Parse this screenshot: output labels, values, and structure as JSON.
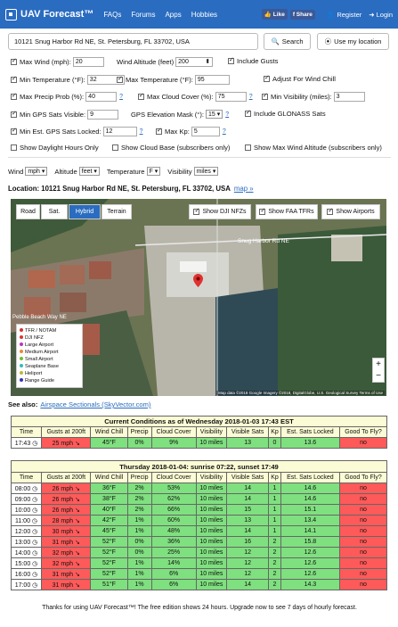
{
  "nav": {
    "brand": "UAV Forecast™",
    "links": [
      "FAQs",
      "Forums",
      "Apps",
      "Hobbies"
    ],
    "fb_like": "Like",
    "fb_share": "Share",
    "register": "Register",
    "login": "Login"
  },
  "search": {
    "value": "10121 Snug Harbor Rd NE, St. Petersburg, FL 33702, USA",
    "button": "Search",
    "location_button": "Use my location"
  },
  "settings": {
    "max_wind_label": "Max Wind (mph):",
    "max_wind": "20",
    "wind_alt_label": "Wind Altitude (feet)",
    "wind_alt": "200",
    "include_gusts": "Include Gusts",
    "min_temp_label": "Min Temperature (°F):",
    "min_temp": "32",
    "max_temp_label": "Max Temperature (°F):",
    "max_temp": "95",
    "wind_chill": "Adjust For Wind Chill",
    "precip_label": "Max Precip Prob (%):",
    "precip": "40",
    "cloud_label": "Max Cloud Cover (%):",
    "cloud": "75",
    "vis_label": "Min Visibility (miles):",
    "vis": "3",
    "gps_vis_label": "Min GPS Sats Visible:",
    "gps_vis": "9",
    "gps_mask_label": "GPS Elevation Mask (°):",
    "gps_mask": "15",
    "glonass": "Include GLONASS Sats",
    "gps_locked_label": "Min Est. GPS Sats Locked:",
    "gps_locked": "12",
    "kp_label": "Max Kp:",
    "kp": "5",
    "daylight": "Show Daylight Hours Only",
    "cloud_base": "Show Cloud Base (subscribers only)",
    "max_wind_alt": "Show Max Wind Altitude (subscribers only)",
    "q": "?"
  },
  "units": {
    "wind_label": "Wind",
    "wind": "mph",
    "alt_label": "Altitude",
    "alt": "feet",
    "temp_label": "Temperature",
    "temp": "F",
    "vis_label": "Visibility",
    "vis": "miles"
  },
  "location": {
    "label": "Location: 10121 Snug Harbor Rd NE, St. Petersburg, FL 33702, USA",
    "map_link": "map »"
  },
  "map": {
    "road": "Road",
    "sat": "Sat.",
    "hybrid": "Hybrid",
    "terrain": "Terrain",
    "nfz": "Show DJI NFZs",
    "tfr": "Show FAA TFRs",
    "airports": "Show Airports",
    "street1": "Snug Harbor Rd NE",
    "street2": "Pebble Beach Way NE",
    "attribution": "Map data ©2018 Google Imagery ©2018, DigitalGlobe, U.S. Geological Survey   Terms of Use",
    "legend": [
      {
        "label": "TFR / NOTAM",
        "color": "#c33"
      },
      {
        "label": "DJI NFZ",
        "color": "#d33"
      },
      {
        "label": "Large Airport",
        "color": "#b3b"
      },
      {
        "label": "Medium Airport",
        "color": "#e83"
      },
      {
        "label": "Small Airport",
        "color": "#7b3"
      },
      {
        "label": "Seaplane Base",
        "color": "#3bb"
      },
      {
        "label": "Heliport",
        "color": "#bb3"
      },
      {
        "label": "Range Guide",
        "color": "#33b"
      }
    ]
  },
  "see_also": {
    "label": "See also:",
    "link": "Airspace Sectionals (SkyVector.com)"
  },
  "current": {
    "title": "Current Conditions as of Wednesday 2018-01-03 17:43 EST",
    "time": "17:43",
    "gusts": "25 mph",
    "chill": "45°F",
    "precip": "0%",
    "cloud": "9%",
    "vis": "10 miles",
    "sats": "13",
    "kp": "0",
    "locked": "13.6",
    "fly": "no"
  },
  "headers": [
    "Time",
    "Gusts at 200ft",
    "Wind Chill",
    "Precip",
    "Cloud Cover",
    "Visibility",
    "Visible Sats",
    "Kp",
    "Est. Sats Locked",
    "Good To Fly?"
  ],
  "day": {
    "title": "Thursday 2018-01-04: sunrise 07:22, sunset 17:49",
    "rows": [
      [
        "08:00",
        "26 mph",
        "36°F",
        "2%",
        "53%",
        "10 miles",
        "14",
        "1",
        "14.6",
        "no"
      ],
      [
        "09:00",
        "26 mph",
        "38°F",
        "2%",
        "62%",
        "10 miles",
        "14",
        "1",
        "14.6",
        "no"
      ],
      [
        "10:00",
        "26 mph",
        "40°F",
        "2%",
        "66%",
        "10 miles",
        "15",
        "1",
        "15.1",
        "no"
      ],
      [
        "11:00",
        "28 mph",
        "42°F",
        "1%",
        "60%",
        "10 miles",
        "13",
        "1",
        "13.4",
        "no"
      ],
      [
        "12:00",
        "30 mph",
        "45°F",
        "1%",
        "48%",
        "10 miles",
        "14",
        "1",
        "14.1",
        "no"
      ],
      [
        "13:00",
        "31 mph",
        "52°F",
        "0%",
        "36%",
        "10 miles",
        "16",
        "2",
        "15.8",
        "no"
      ],
      [
        "14:00",
        "32 mph",
        "52°F",
        "0%",
        "25%",
        "10 miles",
        "12",
        "2",
        "12.6",
        "no"
      ],
      [
        "15:00",
        "32 mph",
        "52°F",
        "1%",
        "14%",
        "10 miles",
        "12",
        "2",
        "12.6",
        "no"
      ],
      [
        "16:00",
        "31 mph",
        "52°F",
        "1%",
        "6%",
        "10 miles",
        "12",
        "2",
        "12.6",
        "no"
      ],
      [
        "17:00",
        "31 mph",
        "51°F",
        "1%",
        "6%",
        "10 miles",
        "14",
        "2",
        "14.3",
        "no"
      ]
    ]
  },
  "footer": "Thanks for using UAV Forecast™! The free edition shows 24 hours. Upgrade now to see 7 days of hourly forecast."
}
